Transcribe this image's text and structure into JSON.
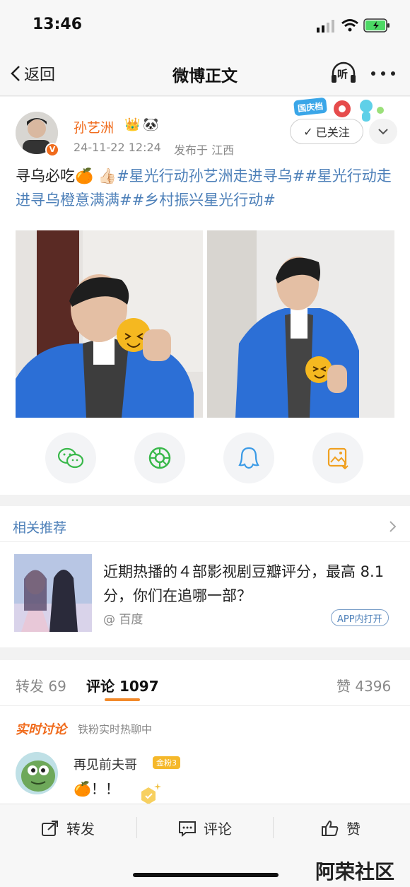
{
  "status_bar": {
    "time": "13:46"
  },
  "nav": {
    "back_label": "返回",
    "title": "微博正文",
    "listen_label": "听"
  },
  "post": {
    "author": "孙艺洲",
    "date": "24-11-22 12:24",
    "location": "发布于 江西",
    "follow_label": "已关注",
    "badge_label": "国庆档",
    "text_plain": "寻乌必吃🍊 👍🏻",
    "tags": [
      "#星光行动孙艺洲走进寻乌#",
      "#星光行动走进寻乌橙意满满#",
      "#乡村振兴星光行动#"
    ]
  },
  "related": {
    "header": "相关推荐",
    "title": "近期热播的４部影视剧豆瓣评分，最高 8.1分，你们在追哪一部？",
    "source": "@ 百度",
    "app_open": "APP内打开"
  },
  "tabs": {
    "repost": "转发 69",
    "comments": "评论 1097",
    "likes": "赞 4396"
  },
  "comments": {
    "realtime_label": "实时讨论",
    "realtime_sub": "铁粉实时热聊中",
    "first_user": "再见前夫哥",
    "first_badge": "金粉3",
    "first_text": "🍊！！"
  },
  "bottom_bar": {
    "repost": "转发",
    "comment": "评论",
    "like": "赞"
  },
  "watermark": "阿荣社区",
  "colors": {
    "accent": "#f28a2b",
    "link": "#4c7fb8",
    "name": "#f06b1c"
  }
}
